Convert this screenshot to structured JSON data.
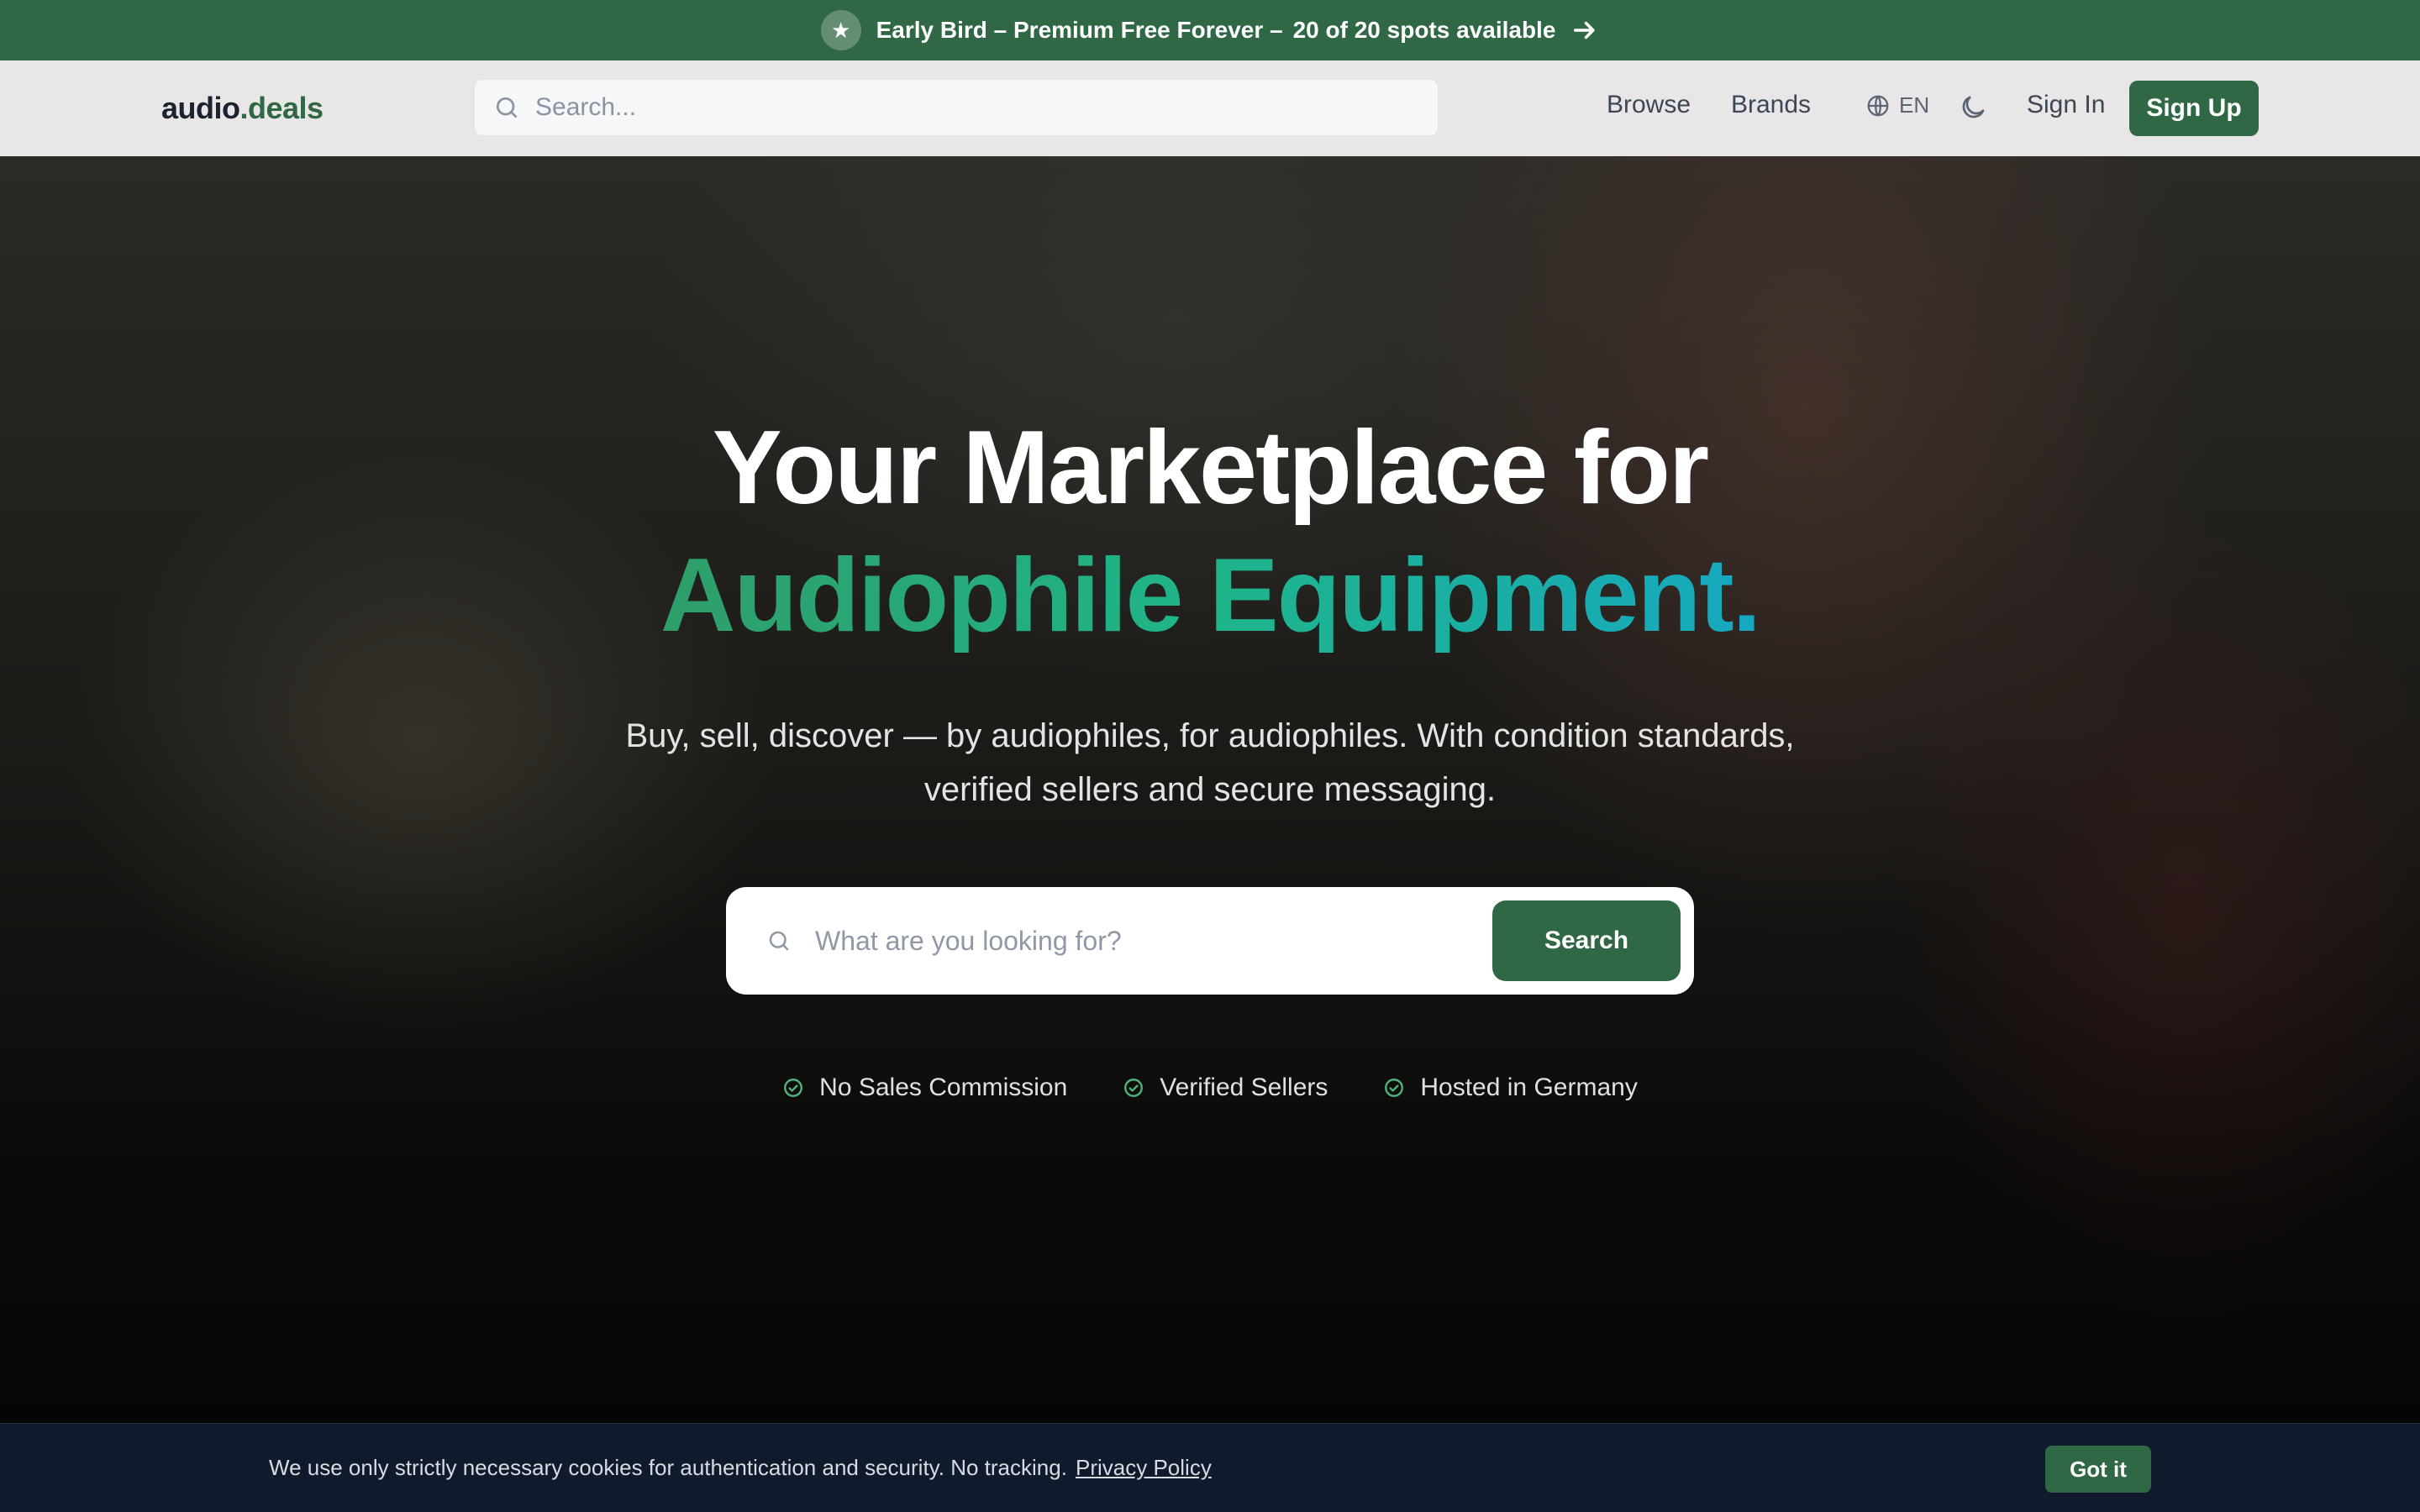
{
  "promo": {
    "text_main": "Early Bird – Premium Free Forever –",
    "text_spots": "20 of 20 spots available",
    "icons": {
      "star": "star-icon",
      "arrow": "arrow-right-icon"
    }
  },
  "header": {
    "logo_main": "audio",
    "logo_accent": ".deals",
    "search_placeholder": "Search...",
    "nav": {
      "browse": "Browse",
      "brands": "Brands"
    },
    "language": "EN",
    "sign_in": "Sign In",
    "sign_up": "Sign Up"
  },
  "hero": {
    "title_line1": "Your Marketplace for",
    "title_line2": "Audiophile Equipment.",
    "subtitle": "Buy, sell, discover — by audiophiles, for audiophiles. With condition standards, verified sellers and secure messaging.",
    "search_placeholder": "What are you looking for?",
    "search_button": "Search",
    "badges": [
      "No Sales Commission",
      "Verified Sellers",
      "Hosted in Germany"
    ]
  },
  "cookie": {
    "message": "We use only strictly necessary cookies for authentication and security. No tracking.",
    "policy_link": "Privacy Policy",
    "accept": "Got it"
  },
  "colors": {
    "brand_green": "#306846",
    "cookie_bg": "#111a2c",
    "header_bg": "#e8e6e6",
    "gradient_start": "#2f9e6a",
    "gradient_end": "#16a8c0"
  }
}
